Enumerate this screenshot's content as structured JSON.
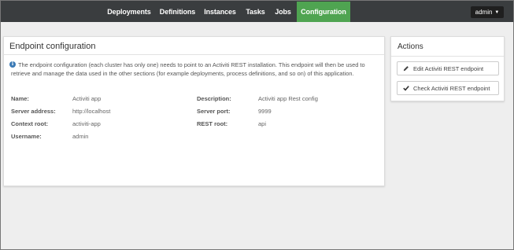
{
  "nav": {
    "tabs": [
      {
        "label": "Deployments"
      },
      {
        "label": "Definitions"
      },
      {
        "label": "Instances"
      },
      {
        "label": "Tasks"
      },
      {
        "label": "Jobs"
      },
      {
        "label": "Configuration"
      }
    ],
    "active_tab": "Configuration",
    "user_label": "admin",
    "active_color": "#4fa451",
    "bar_color": "#3a3d3f"
  },
  "endpoint": {
    "title": "Endpoint configuration",
    "info": "The endpoint configuration (each cluster has only one) needs to point to an Activiti REST installation. This endpoint will then be used to retrieve and manage the data used in the other sections (for example deployments, process definitions, and so on) of this application.",
    "fields": {
      "name_label": "Name:",
      "name_value": "Activiti app",
      "server_address_label": "Server address:",
      "server_address_value": "http://localhost",
      "context_root_label": "Context root:",
      "context_root_value": "activiti-app",
      "username_label": "Username:",
      "username_value": "admin",
      "description_label": "Description:",
      "description_value": "Activiti app Rest config",
      "server_port_label": "Server port:",
      "server_port_value": "9999",
      "rest_root_label": "REST root:",
      "rest_root_value": "api"
    }
  },
  "actions": {
    "title": "Actions",
    "edit_label": "Edit Activiti REST endpoint",
    "check_label": "Check Activiti REST endpoint",
    "edit_icon": "pencil-icon",
    "check_icon": "checkmark-icon"
  }
}
